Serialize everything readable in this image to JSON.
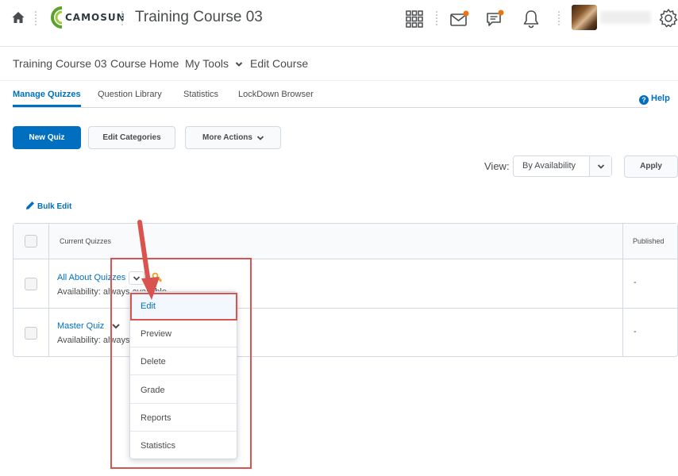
{
  "header": {
    "logo_text": "CAMOSUN",
    "course_title": "Training Course 03",
    "icons": [
      "home-icon",
      "apps-grid-icon",
      "mail-icon",
      "chat-icon",
      "bell-icon",
      "settings-gear-icon"
    ],
    "notification_color": "#e87511"
  },
  "nav": {
    "items": [
      "Training Course 03",
      "Course Home",
      "My Tools",
      "Edit Course"
    ]
  },
  "tabs": {
    "items": [
      "Manage Quizzes",
      "Question Library",
      "Statistics",
      "LockDown Browser"
    ],
    "active": "Manage Quizzes",
    "help_label": "Help"
  },
  "toolbar": {
    "new_quiz": "New Quiz",
    "edit_categories": "Edit Categories",
    "more_actions": "More Actions",
    "view_label": "View:",
    "view_value": "By Availability",
    "apply": "Apply",
    "bulk_edit": "Bulk Edit"
  },
  "table": {
    "col_current": "Current Quizzes",
    "col_published": "Published",
    "rows": [
      {
        "name": "All About Quizzes",
        "availability": "Availability: always available",
        "published": "-"
      },
      {
        "name": "Master Quiz",
        "availability": "Availability: always available",
        "published": "-"
      }
    ]
  },
  "menu": {
    "items": [
      "Edit",
      "Preview",
      "Delete",
      "Grade",
      "Reports",
      "Statistics"
    ]
  },
  "colors": {
    "accent": "#006fbf",
    "annotation": "#d9534f"
  }
}
